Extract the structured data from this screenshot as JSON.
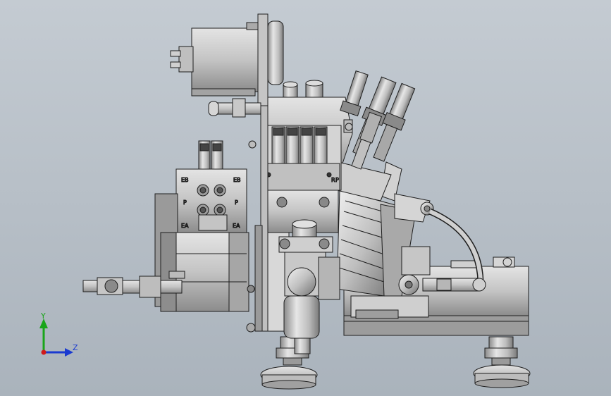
{
  "colors": {
    "background_top": "#c4cbd2",
    "background_bottom": "#aab3bc",
    "part_light": "#dcdcdc",
    "part_mid": "#b9b9b9",
    "part_dark": "#6e6e6e",
    "edge": "#1e1e1e",
    "axis_y": "#1aa51a",
    "axis_z": "#1a3ad0",
    "axis_origin": "#d01a1a"
  },
  "labels": {
    "manifold_eb": "EB",
    "manifold_p": "P",
    "manifold_ea": "EA",
    "manifold_eb_right": "EB",
    "manifold_p_right": "P",
    "manifold_ea_right": "EA",
    "valve_block_r": "R",
    "valve_block_p": "P"
  },
  "triad": {
    "y_label": "Y",
    "z_label": "Z"
  }
}
